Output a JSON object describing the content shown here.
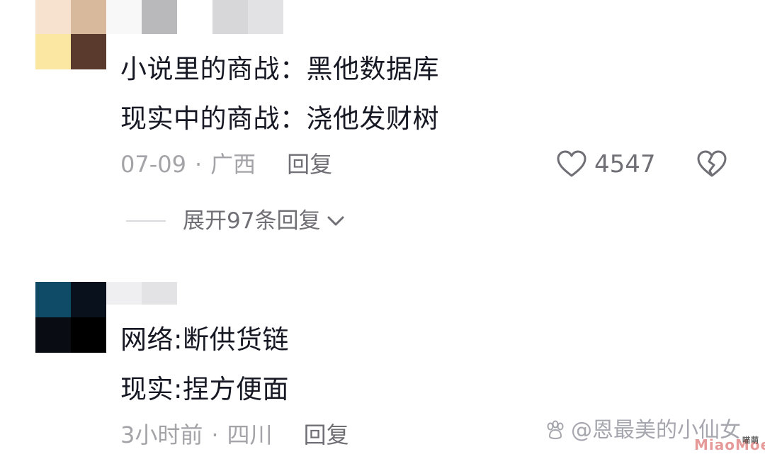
{
  "colors": {
    "text_primary": "#161823",
    "text_secondary": "#a3a3a8",
    "action_text": "#6f6f75",
    "background": "#ffffff"
  },
  "comments": [
    {
      "lines": [
        "小说里的商战：黑他数据库",
        "现实中的商战：浇他发财树"
      ],
      "date": "07-09",
      "separator": "·",
      "location": "广西",
      "reply_label": "回复",
      "like_icon": "heart-outline-icon",
      "like_count": "4547",
      "dislike_icon": "broken-heart-icon",
      "expand_replies_label": "展开97条回复",
      "expand_icon": "chevron-down-icon"
    },
    {
      "lines": [
        "网络:断供货链",
        "现实:捏方便面"
      ],
      "date": "3小时前",
      "separator": "·",
      "location": "四川",
      "reply_label": "回复"
    }
  ],
  "watermark": {
    "icon": "paw-icon",
    "text": "@恩最美的小仙女"
  },
  "stamp": {
    "text": "MiaoMoe",
    "sub": "喵萌"
  }
}
